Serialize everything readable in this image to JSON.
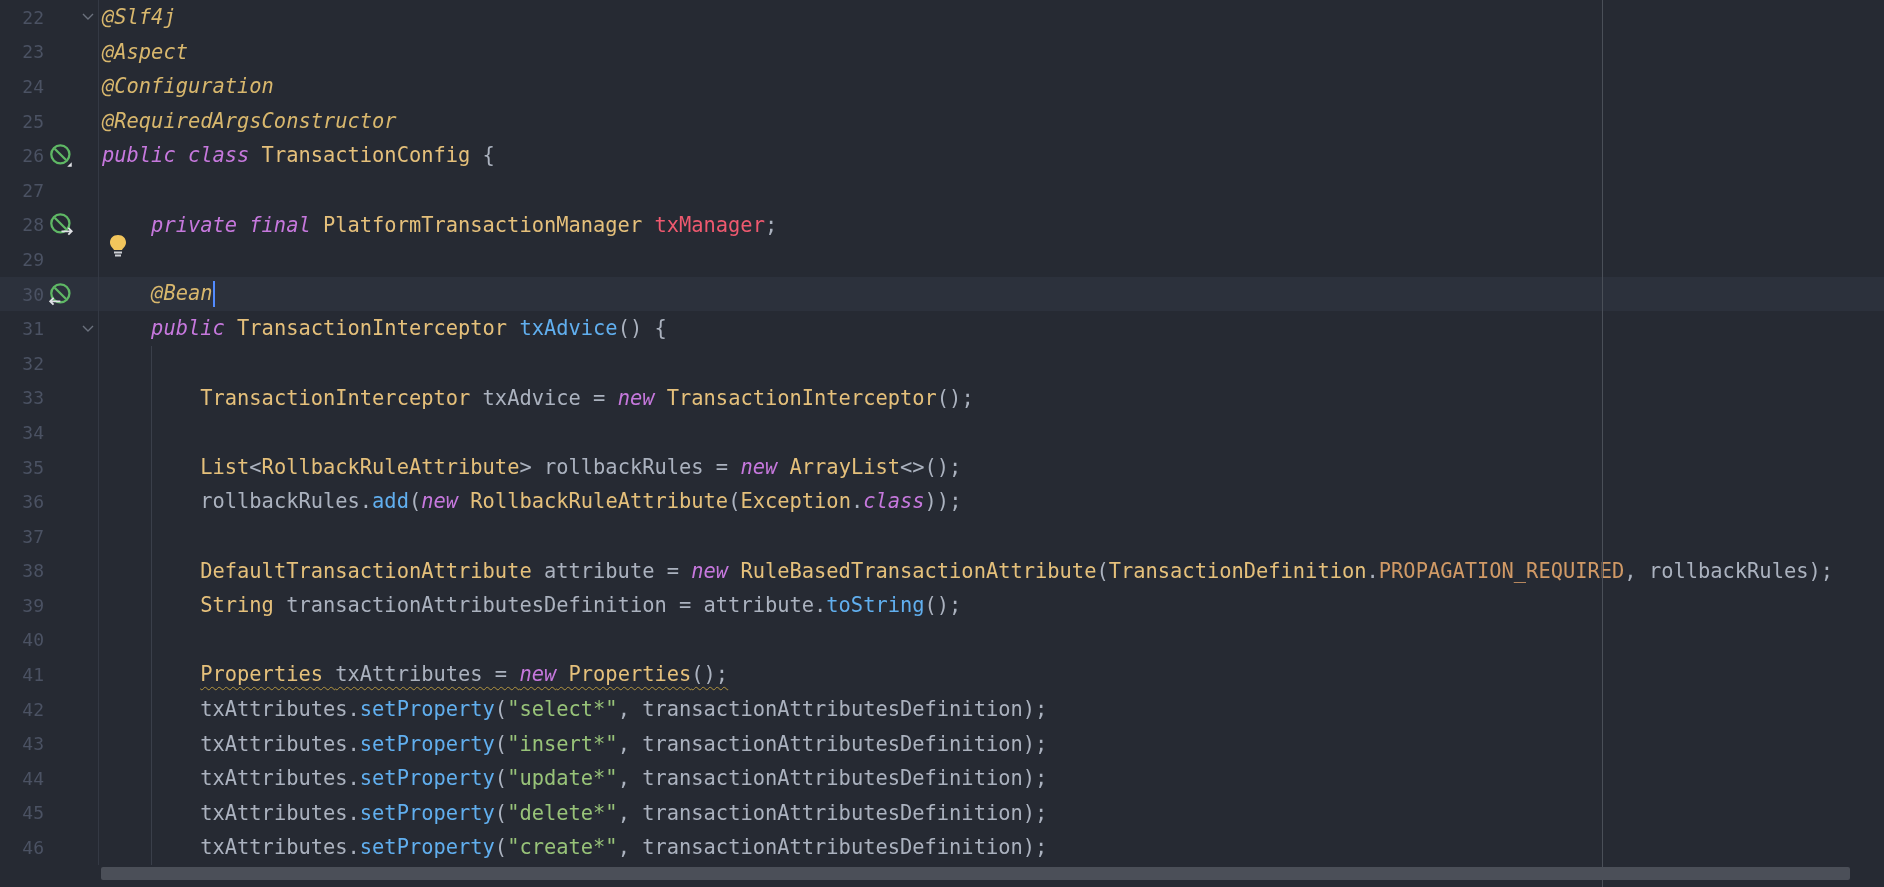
{
  "editor": {
    "lines": [
      {
        "number": "22",
        "fold": true,
        "tokens": [
          {
            "text": "@Slf4j",
            "kind": "annotation"
          }
        ]
      },
      {
        "number": "23",
        "tokens": [
          {
            "text": "@Aspect",
            "kind": "annotation"
          }
        ]
      },
      {
        "number": "24",
        "tokens": [
          {
            "text": "@Configuration",
            "kind": "annotation"
          }
        ]
      },
      {
        "number": "25",
        "tokens": [
          {
            "text": "@RequiredArgsConstructor",
            "kind": "annotation"
          }
        ]
      },
      {
        "number": "26",
        "kind": "bean",
        "tokens": [
          {
            "text": "public class",
            "kind": "keyword"
          },
          {
            "text": " TransactionConfig ",
            "kind": "type"
          },
          {
            "text": "{",
            "kind": "plain"
          }
        ]
      },
      {
        "number": "27"
      },
      {
        "number": "28",
        "kind": "injected",
        "tokens": [
          {
            "text": "    private final",
            "kind": "keyword"
          },
          {
            "text": " PlatformTransactionManager ",
            "kind": "type"
          },
          {
            "text": "txManager",
            "kind": "field"
          },
          {
            "text": ";",
            "kind": "plain"
          }
        ]
      },
      {
        "number": "29",
        "intention": true
      },
      {
        "number": "30",
        "kind": "provider",
        "current": true,
        "caret": true,
        "tokens": [
          {
            "text": "    @Bean",
            "kind": "annotation"
          }
        ]
      },
      {
        "number": "31",
        "fold": true,
        "tokens": [
          {
            "text": "    public",
            "kind": "keyword"
          },
          {
            "text": " TransactionInterceptor ",
            "kind": "type"
          },
          {
            "text": "txAdvice",
            "kind": "method"
          },
          {
            "text": "() {",
            "kind": "plain"
          }
        ]
      },
      {
        "number": "32"
      },
      {
        "number": "33",
        "tokens": [
          {
            "text": "        TransactionInterceptor ",
            "kind": "type"
          },
          {
            "text": "txAdvice = ",
            "kind": "plain"
          },
          {
            "text": "new",
            "kind": "keyword"
          },
          {
            "text": " TransactionInterceptor",
            "kind": "type"
          },
          {
            "text": "();",
            "kind": "plain"
          }
        ]
      },
      {
        "number": "34"
      },
      {
        "number": "35",
        "tokens": [
          {
            "text": "        List",
            "kind": "type"
          },
          {
            "text": "<",
            "kind": "plain"
          },
          {
            "text": "RollbackRuleAttribute",
            "kind": "type"
          },
          {
            "text": "> rollbackRules = ",
            "kind": "plain"
          },
          {
            "text": "new",
            "kind": "keyword"
          },
          {
            "text": " ArrayList",
            "kind": "type"
          },
          {
            "text": "<>();",
            "kind": "plain"
          }
        ]
      },
      {
        "number": "36",
        "tokens": [
          {
            "text": "        rollbackRules.",
            "kind": "plain"
          },
          {
            "text": "add",
            "kind": "method"
          },
          {
            "text": "(",
            "kind": "plain"
          },
          {
            "text": "new",
            "kind": "keyword"
          },
          {
            "text": " RollbackRuleAttribute",
            "kind": "type"
          },
          {
            "text": "(",
            "kind": "plain"
          },
          {
            "text": "Exception",
            "kind": "type"
          },
          {
            "text": ".",
            "kind": "plain"
          },
          {
            "text": "class",
            "kind": "keyword"
          },
          {
            "text": "));",
            "kind": "plain"
          }
        ]
      },
      {
        "number": "37"
      },
      {
        "number": "38",
        "tokens": [
          {
            "text": "        DefaultTransactionAttribute ",
            "kind": "type"
          },
          {
            "text": "attribute = ",
            "kind": "plain"
          },
          {
            "text": "new",
            "kind": "keyword"
          },
          {
            "text": " RuleBasedTransactionAttribute",
            "kind": "type"
          },
          {
            "text": "(",
            "kind": "plain"
          },
          {
            "text": "TransactionDefinition",
            "kind": "type"
          },
          {
            "text": ".",
            "kind": "plain"
          },
          {
            "text": "PROPAGATION_REQUIRED",
            "kind": "constant"
          },
          {
            "text": ", rollbackRules);",
            "kind": "plain"
          }
        ]
      },
      {
        "number": "39",
        "tokens": [
          {
            "text": "        String ",
            "kind": "type"
          },
          {
            "text": "transactionAttributesDefinition = attribute.",
            "kind": "plain"
          },
          {
            "text": "toString",
            "kind": "method"
          },
          {
            "text": "();",
            "kind": "plain"
          }
        ]
      },
      {
        "number": "40"
      },
      {
        "number": "41",
        "warning": true,
        "tokens": [
          {
            "text": "        Properties ",
            "kind": "type"
          },
          {
            "text": "txAttributes = ",
            "kind": "plain"
          },
          {
            "text": "new",
            "kind": "keyword"
          },
          {
            "text": " Properties",
            "kind": "type"
          },
          {
            "text": "();",
            "kind": "plain"
          }
        ]
      },
      {
        "number": "42",
        "tokens": [
          {
            "text": "        txAttributes.",
            "kind": "plain"
          },
          {
            "text": "setProperty",
            "kind": "method"
          },
          {
            "text": "(",
            "kind": "plain"
          },
          {
            "text": "\"select*\"",
            "kind": "string"
          },
          {
            "text": ", transactionAttributesDefinition);",
            "kind": "plain"
          }
        ]
      },
      {
        "number": "43",
        "tokens": [
          {
            "text": "        txAttributes.",
            "kind": "plain"
          },
          {
            "text": "setProperty",
            "kind": "method"
          },
          {
            "text": "(",
            "kind": "plain"
          },
          {
            "text": "\"insert*\"",
            "kind": "string"
          },
          {
            "text": ", transactionAttributesDefinition);",
            "kind": "plain"
          }
        ]
      },
      {
        "number": "44",
        "tokens": [
          {
            "text": "        txAttributes.",
            "kind": "plain"
          },
          {
            "text": "setProperty",
            "kind": "method"
          },
          {
            "text": "(",
            "kind": "plain"
          },
          {
            "text": "\"update*\"",
            "kind": "string"
          },
          {
            "text": ", transactionAttributesDefinition);",
            "kind": "plain"
          }
        ]
      },
      {
        "number": "45",
        "tokens": [
          {
            "text": "        txAttributes.",
            "kind": "plain"
          },
          {
            "text": "setProperty",
            "kind": "method"
          },
          {
            "text": "(",
            "kind": "plain"
          },
          {
            "text": "\"delete*\"",
            "kind": "string"
          },
          {
            "text": ", transactionAttributesDefinition);",
            "kind": "plain"
          }
        ]
      },
      {
        "number": "46",
        "tokens": [
          {
            "text": "        txAttributes.",
            "kind": "plain"
          },
          {
            "text": "setProperty",
            "kind": "method"
          },
          {
            "text": "(",
            "kind": "plain"
          },
          {
            "text": "\"create*\"",
            "kind": "string"
          },
          {
            "text": ", transactionAttributesDefinition);",
            "kind": "plain"
          }
        ]
      }
    ]
  }
}
